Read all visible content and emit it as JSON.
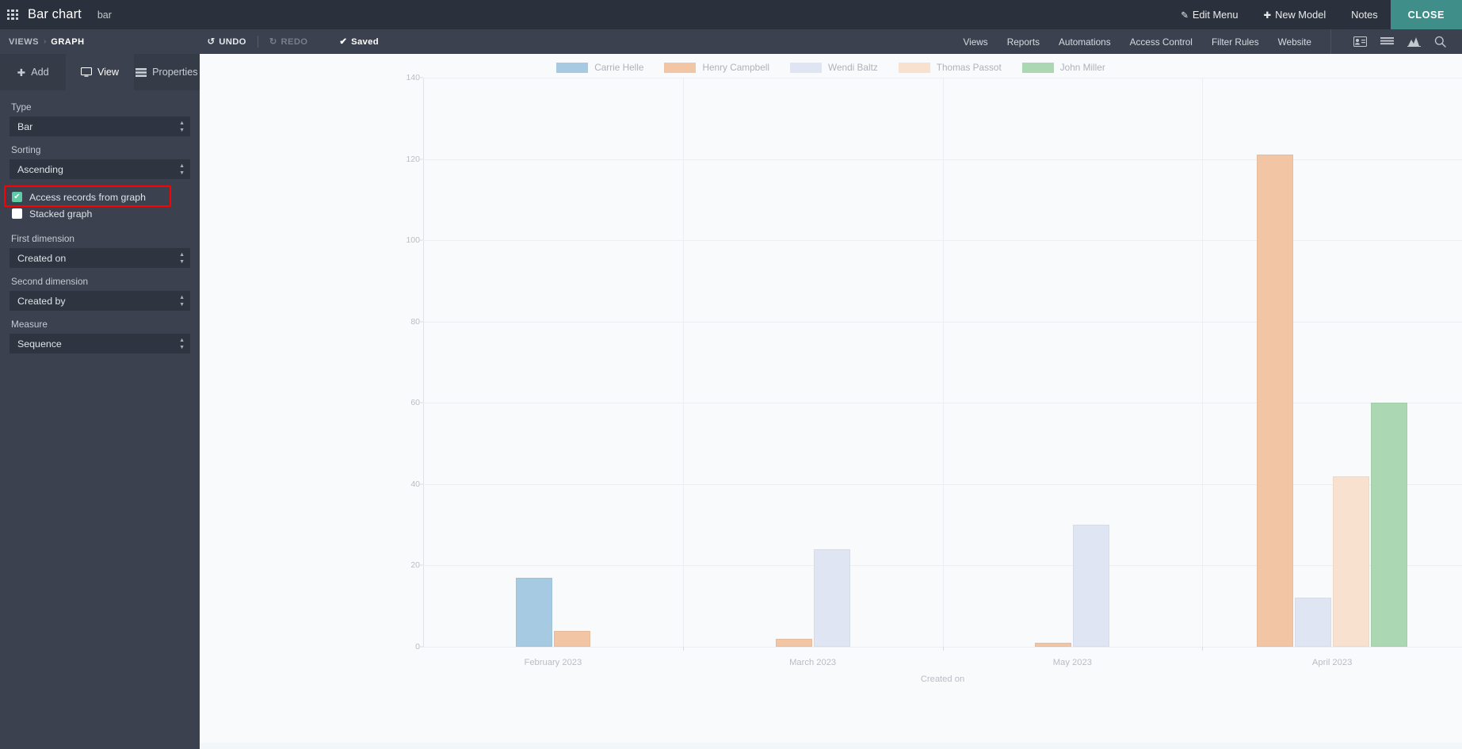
{
  "topbar": {
    "app_title": "Bar chart",
    "app_subtitle": "bar",
    "apps_icon": "apps-grid-icon",
    "right_items": [
      {
        "label": "Edit Menu",
        "icon": "pencil-icon"
      },
      {
        "label": "New Model",
        "icon": "plus-icon"
      },
      {
        "label": "Notes",
        "icon": ""
      },
      {
        "label": "CLOSE",
        "icon": ""
      }
    ]
  },
  "subbar": {
    "breadcrumb_root": "VIEWS",
    "breadcrumb_sep": "›",
    "breadcrumb_current": "GRAPH",
    "undo_label": "UNDO",
    "redo_label": "REDO",
    "saved_label": "Saved",
    "nav_items": [
      "Views",
      "Reports",
      "Automations",
      "Access Control",
      "Filter Rules",
      "Website"
    ],
    "icons": [
      "kanban-card-icon",
      "list-icon",
      "graph-icon",
      "search-icon"
    ]
  },
  "sidebar": {
    "tabs": [
      {
        "label": "Add",
        "icon": "plus-icon",
        "active": false
      },
      {
        "label": "View",
        "icon": "monitor-icon",
        "active": true
      },
      {
        "label": "Properties",
        "icon": "properties-icon",
        "active": false
      }
    ],
    "fields": [
      {
        "label": "Type",
        "value": "Bar",
        "name": "type-select"
      },
      {
        "label": "Sorting",
        "value": "Ascending",
        "name": "sorting-select"
      }
    ],
    "checkboxes": [
      {
        "label": "Access records from graph",
        "checked": true,
        "highlighted": true
      },
      {
        "label": "Stacked graph",
        "checked": false,
        "highlighted": false
      }
    ],
    "dimension_fields": [
      {
        "label": "First dimension",
        "value": "Created on",
        "name": "first-dimension-select"
      },
      {
        "label": "Second dimension",
        "value": "Created by",
        "name": "second-dimension-select"
      },
      {
        "label": "Measure",
        "value": "Sequence",
        "name": "measure-select"
      }
    ]
  },
  "chart_data": {
    "type": "bar",
    "title": "",
    "xlabel": "Created on",
    "ylabel": "",
    "ylim": [
      0,
      140
    ],
    "yticks": [
      0,
      20,
      40,
      60,
      80,
      100,
      120,
      140
    ],
    "grid": true,
    "legend_position": "top",
    "categories": [
      "February 2023",
      "March 2023",
      "May 2023",
      "April 2023"
    ],
    "series": [
      {
        "name": "Carrie Helle",
        "color": "#a7cae3",
        "values": [
          17,
          0,
          0,
          0
        ]
      },
      {
        "name": "Henry Campbell",
        "color": "#f2c5a4",
        "values": [
          4,
          2,
          1,
          121
        ]
      },
      {
        "name": "Wendi Baltz",
        "color": "#e0e5f3",
        "values": [
          0,
          24,
          30,
          12
        ]
      },
      {
        "name": "Thomas Passot",
        "color": "#f8e2cf",
        "values": [
          0,
          0,
          0,
          42
        ]
      },
      {
        "name": "John Miller",
        "color": "#abd7b3",
        "values": [
          0,
          0,
          0,
          60
        ]
      }
    ]
  },
  "colors": {
    "accent_close": "#3f8e8a",
    "checkbox_on": "#5fcba4",
    "highlight": "#ff0000",
    "topbar_bg": "#2b313c",
    "subbar_bg": "#3b414e",
    "chart_bg": "#f8fafb"
  }
}
